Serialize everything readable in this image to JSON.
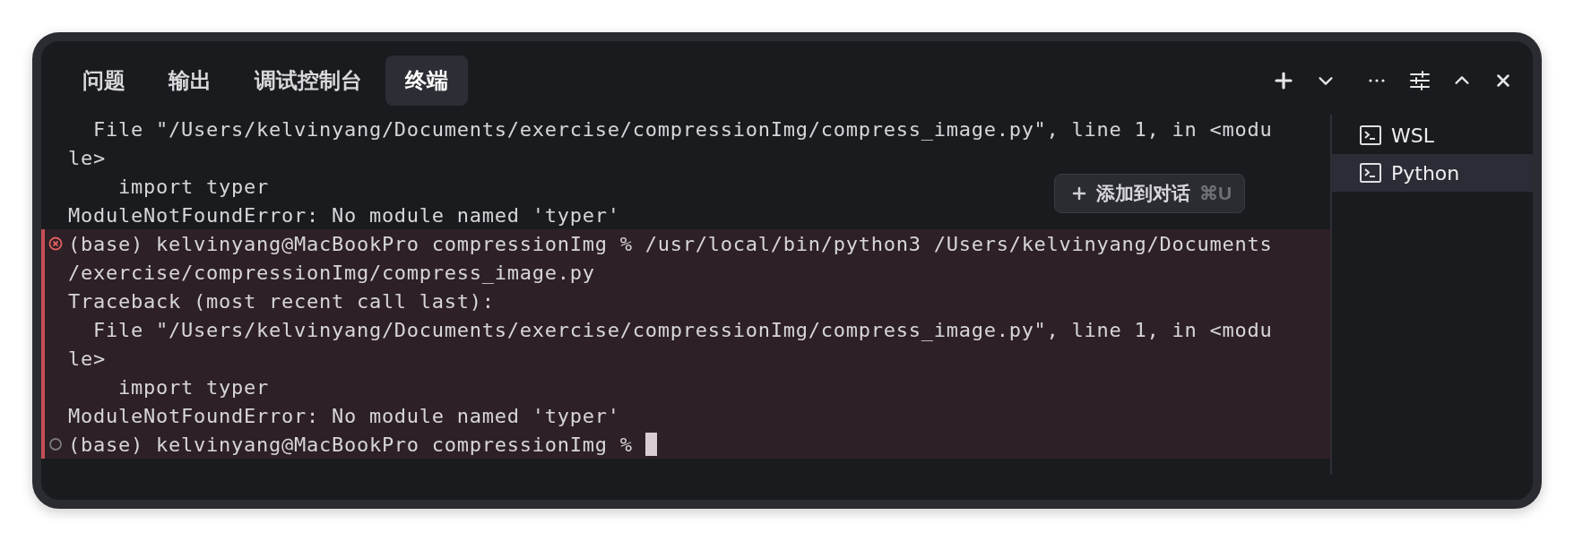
{
  "tabs": [
    {
      "label": "问题",
      "selected": false
    },
    {
      "label": "输出",
      "selected": false
    },
    {
      "label": "调试控制台",
      "selected": false
    },
    {
      "label": "终端",
      "selected": true
    }
  ],
  "toolbar": [
    {
      "kind": "plus"
    },
    {
      "kind": "chevron-down"
    },
    {
      "kind": "more"
    },
    {
      "kind": "sliders"
    },
    {
      "kind": "chevron-up"
    },
    {
      "kind": "close"
    }
  ],
  "terminal": {
    "blocks": [
      {
        "highlighted": false,
        "lines": [
          {
            "kind": "output",
            "text": "  File \"/Users/kelvinyang/Documents/exercise/compressionImg/compress_image.py\", line 1, in <modu",
            "cursor": false
          },
          {
            "kind": "output",
            "text": "le>",
            "cursor": false
          },
          {
            "kind": "output",
            "text": "    import typer",
            "cursor": false
          },
          {
            "kind": "output",
            "text": "ModuleNotFoundError: No module named 'typer'",
            "cursor": false
          }
        ]
      },
      {
        "highlighted": true,
        "lines": [
          {
            "kind": "error",
            "text": "(base) kelvinyang@MacBookPro compressionImg % /usr/local/bin/python3 /Users/kelvinyang/Documents",
            "cursor": false
          },
          {
            "kind": "output",
            "text": "/exercise/compressionImg/compress_image.py",
            "cursor": false
          },
          {
            "kind": "output",
            "text": "Traceback (most recent call last):",
            "cursor": false
          },
          {
            "kind": "output",
            "text": "  File \"/Users/kelvinyang/Documents/exercise/compressionImg/compress_image.py\", line 1, in <modu",
            "cursor": false
          },
          {
            "kind": "output",
            "text": "le>",
            "cursor": false
          },
          {
            "kind": "output",
            "text": "    import typer",
            "cursor": false
          },
          {
            "kind": "output",
            "text": "ModuleNotFoundError: No module named 'typer'",
            "cursor": false
          },
          {
            "kind": "prompt",
            "text": "(base) kelvinyang@MacBookPro compressionImg % ",
            "cursor": true
          }
        ]
      }
    ]
  },
  "add_to_chat": {
    "label": "添加到对话",
    "shortcut": "⌘U"
  },
  "sessions": [
    {
      "label": "WSL",
      "selected": false
    },
    {
      "label": "Python",
      "selected": true
    }
  ]
}
